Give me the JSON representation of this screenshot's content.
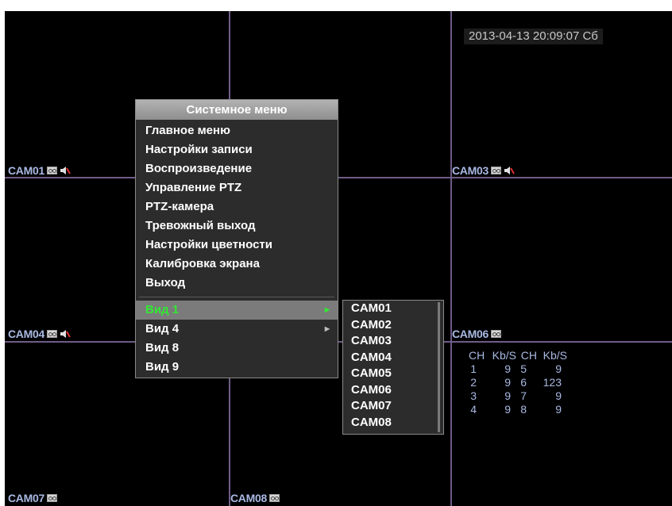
{
  "datetime": "2013-04-13 20:09:07 Сб",
  "cameras": [
    {
      "label": "CAM01",
      "rec": true,
      "mute": true
    },
    {
      "label": "CAM03",
      "rec": true,
      "mute": true
    },
    {
      "label": "CAM04",
      "rec": true,
      "mute": true
    },
    {
      "label": "CAM06",
      "rec": true,
      "mute": false
    },
    {
      "label": "CAM07",
      "rec": true,
      "mute": false
    },
    {
      "label": "CAM08",
      "rec": true,
      "mute": false
    }
  ],
  "stats": {
    "headers": [
      "CH",
      "Kb/S",
      "CH",
      "Kb/S"
    ],
    "rows": [
      [
        "1",
        "9",
        "5",
        "9"
      ],
      [
        "2",
        "9",
        "6",
        "123"
      ],
      [
        "3",
        "9",
        "7",
        "9"
      ],
      [
        "4",
        "9",
        "8",
        "9"
      ]
    ]
  },
  "system_menu": {
    "title": "Системное меню",
    "items": [
      "Главное меню",
      "Настройки записи",
      "Воспроизведение",
      "Управление PTZ",
      "PTZ-камера",
      "Тревожный выход",
      "Настройки цветности",
      "Калибровка экрана",
      "Выход"
    ],
    "views": [
      {
        "label": "Вид 1",
        "submenu": true,
        "selected": true
      },
      {
        "label": "Вид 4",
        "submenu": true,
        "selected": false
      },
      {
        "label": "Вид 8",
        "submenu": false,
        "selected": false
      },
      {
        "label": "Вид 9",
        "submenu": false,
        "selected": false
      }
    ]
  },
  "submenu": {
    "items": [
      "CAM01",
      "CAM02",
      "CAM03",
      "CAM04",
      "CAM05",
      "CAM06",
      "CAM07",
      "CAM08"
    ]
  },
  "colors": {
    "grid": "#6f5c86",
    "label": "#a9b9e3",
    "selected_text": "#33e833"
  },
  "icons": {
    "rec": "record-tape-icon",
    "mute": "speaker-muted-icon",
    "arrow": "submenu-arrow-icon"
  }
}
